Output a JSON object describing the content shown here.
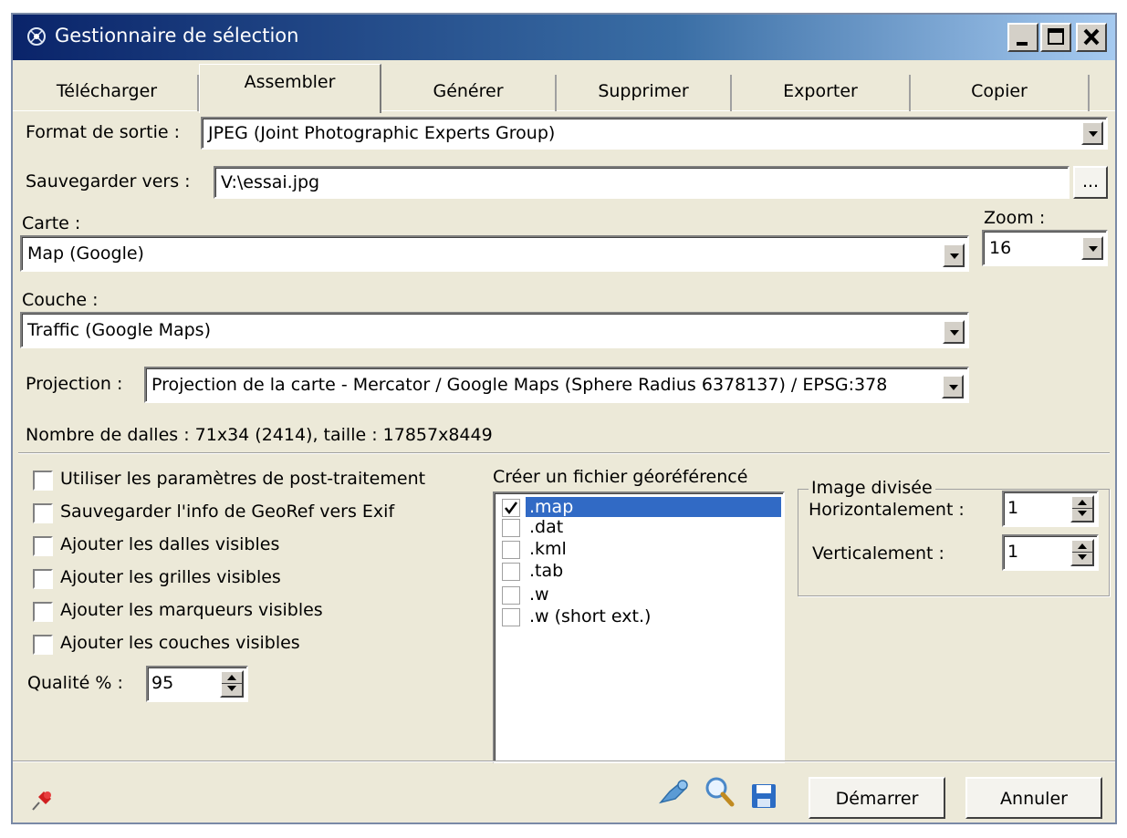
{
  "window": {
    "title": "Gestionnaire de sélection",
    "app_icon": "app-icon",
    "controls": [
      "minimize-icon",
      "maximize-icon",
      "close-icon"
    ]
  },
  "tabs": [
    {
      "label": "Télécharger",
      "active": false
    },
    {
      "label": "Assembler",
      "active": true
    },
    {
      "label": "Générer",
      "active": false
    },
    {
      "label": "Supprimer",
      "active": false
    },
    {
      "label": "Exporter",
      "active": false
    },
    {
      "label": "Copier",
      "active": false
    }
  ],
  "format": {
    "label": "Format de sortie :",
    "value": "JPEG (Joint Photographic Experts Group)"
  },
  "save": {
    "label": "Sauvegarder vers :",
    "value": "V:\\essai.jpg",
    "browse_label": "..."
  },
  "carte": {
    "label": "Carte :",
    "value": "Map (Google)"
  },
  "zoom": {
    "label": "Zoom :",
    "value": "16"
  },
  "couche": {
    "label": "Couche :",
    "value": "Traffic (Google Maps)"
  },
  "projection": {
    "label": "Projection :",
    "value": "Projection de la carte - Mercator / Google Maps (Sphere Radius 6378137) / EPSG:378"
  },
  "info": {
    "tiles": "Nombre de dalles : 71x34 (2414), taille : 17857x8449"
  },
  "options": [
    {
      "label": "Utiliser les paramètres de post-traitement",
      "checked": false
    },
    {
      "label": "Sauvegarder l'info de GeoRef vers Exif",
      "checked": false
    },
    {
      "label": "Ajouter les dalles visibles",
      "checked": false
    },
    {
      "label": "Ajouter les grilles visibles",
      "checked": false
    },
    {
      "label": "Ajouter les marqueurs visibles",
      "checked": false
    },
    {
      "label": "Ajouter les couches visibles",
      "checked": false
    }
  ],
  "quality": {
    "label": "Qualité % :",
    "value": "95"
  },
  "georef": {
    "title": "Créer un fichier géoréférencé",
    "items": [
      {
        "label": ".map",
        "checked": true,
        "selected": true
      },
      {
        "label": ".dat",
        "checked": false,
        "selected": false
      },
      {
        "label": ".kml",
        "checked": false,
        "selected": false
      },
      {
        "label": ".tab",
        "checked": false,
        "selected": false
      },
      {
        "label": ".w",
        "checked": false,
        "selected": false
      },
      {
        "label": ".w (short ext.)",
        "checked": false,
        "selected": false
      }
    ]
  },
  "split": {
    "title": "Image divisée",
    "horizontal_label": "Horizontalement :",
    "horizontal_value": "1",
    "vertical_label": "Verticalement :",
    "vertical_value": "1"
  },
  "footer": {
    "pin_icon": "pin-icon",
    "tool_icons": [
      "map-pin-icon",
      "magnifier-icon",
      "save-icon"
    ],
    "start_label": "Démarrer",
    "cancel_label": "Annuler"
  },
  "colors": {
    "titlebar_start": "#0a246a",
    "titlebar_end": "#a6caf0",
    "dialog_bg": "#ece9d8",
    "selection": "#316ac5"
  }
}
